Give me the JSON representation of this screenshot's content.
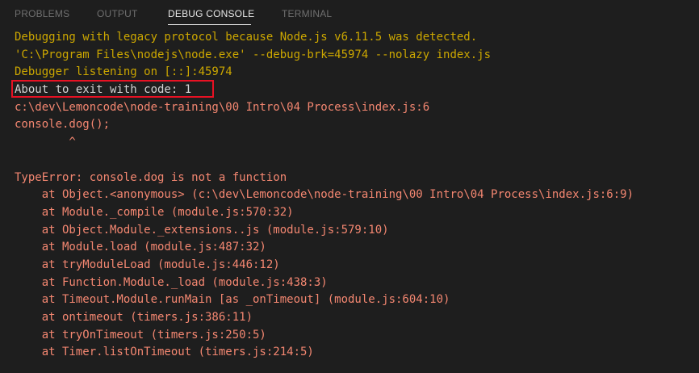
{
  "panel": {
    "tabs": [
      {
        "label": "PROBLEMS"
      },
      {
        "label": "OUTPUT"
      },
      {
        "label": "DEBUG CONSOLE"
      },
      {
        "label": "TERMINAL"
      }
    ],
    "active_tab": "DEBUG CONSOLE"
  },
  "console": {
    "lines": [
      {
        "text": "Debugging with legacy protocol because Node.js v6.11.5 was detected.",
        "kind": "warning"
      },
      {
        "text": "'C:\\Program Files\\nodejs\\node.exe' --debug-brk=45974 --nolazy index.js",
        "kind": "warning"
      },
      {
        "text": "Debugger listening on [::]:45974",
        "kind": "warning"
      },
      {
        "text": "About to exit with code: 1",
        "kind": "output",
        "highlighted": true
      },
      {
        "text": "c:\\dev\\Lemoncode\\node-training\\00 Intro\\04 Process\\index.js:6",
        "kind": "error"
      },
      {
        "text": "console.dog();",
        "kind": "error"
      },
      {
        "text": "        ^",
        "kind": "error"
      },
      {
        "text": "",
        "kind": "error"
      },
      {
        "text": "TypeError: console.dog is not a function",
        "kind": "error"
      },
      {
        "text": "    at Object.<anonymous> (c:\\dev\\Lemoncode\\node-training\\00 Intro\\04 Process\\index.js:6:9)",
        "kind": "error"
      },
      {
        "text": "    at Module._compile (module.js:570:32)",
        "kind": "error"
      },
      {
        "text": "    at Object.Module._extensions..js (module.js:579:10)",
        "kind": "error"
      },
      {
        "text": "    at Module.load (module.js:487:32)",
        "kind": "error"
      },
      {
        "text": "    at tryModuleLoad (module.js:446:12)",
        "kind": "error"
      },
      {
        "text": "    at Function.Module._load (module.js:438:3)",
        "kind": "error"
      },
      {
        "text": "    at Timeout.Module.runMain [as _onTimeout] (module.js:604:10)",
        "kind": "error"
      },
      {
        "text": "    at ontimeout (timers.js:386:11)",
        "kind": "error"
      },
      {
        "text": "    at tryOnTimeout (timers.js:250:5)",
        "kind": "error"
      },
      {
        "text": "    at Timer.listOnTimeout (timers.js:214:5)",
        "kind": "error"
      }
    ]
  },
  "colors": {
    "background": "#1e1e1e",
    "warning_text": "#cca700",
    "output_text": "#d4d4d4",
    "error_text": "#f48771",
    "highlight_border": "#e81123",
    "active_tab_text": "#e7e7e7",
    "inactive_tab_text": "#6f6f6f"
  }
}
